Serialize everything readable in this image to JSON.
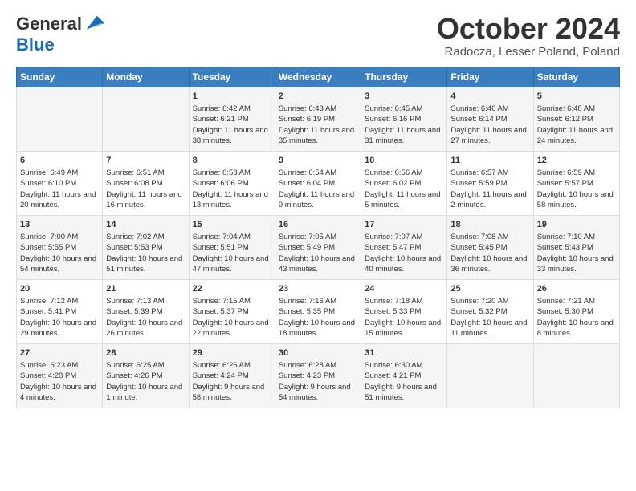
{
  "header": {
    "logo_line1": "General",
    "logo_line2": "Blue",
    "month": "October 2024",
    "location": "Radocza, Lesser Poland, Poland"
  },
  "days_of_week": [
    "Sunday",
    "Monday",
    "Tuesday",
    "Wednesday",
    "Thursday",
    "Friday",
    "Saturday"
  ],
  "weeks": [
    [
      {
        "day": "",
        "content": ""
      },
      {
        "day": "",
        "content": ""
      },
      {
        "day": "1",
        "content": "Sunrise: 6:42 AM\nSunset: 6:21 PM\nDaylight: 11 hours and 38 minutes."
      },
      {
        "day": "2",
        "content": "Sunrise: 6:43 AM\nSunset: 6:19 PM\nDaylight: 11 hours and 35 minutes."
      },
      {
        "day": "3",
        "content": "Sunrise: 6:45 AM\nSunset: 6:16 PM\nDaylight: 11 hours and 31 minutes."
      },
      {
        "day": "4",
        "content": "Sunrise: 6:46 AM\nSunset: 6:14 PM\nDaylight: 11 hours and 27 minutes."
      },
      {
        "day": "5",
        "content": "Sunrise: 6:48 AM\nSunset: 6:12 PM\nDaylight: 11 hours and 24 minutes."
      }
    ],
    [
      {
        "day": "6",
        "content": "Sunrise: 6:49 AM\nSunset: 6:10 PM\nDaylight: 11 hours and 20 minutes."
      },
      {
        "day": "7",
        "content": "Sunrise: 6:51 AM\nSunset: 6:08 PM\nDaylight: 11 hours and 16 minutes."
      },
      {
        "day": "8",
        "content": "Sunrise: 6:53 AM\nSunset: 6:06 PM\nDaylight: 11 hours and 13 minutes."
      },
      {
        "day": "9",
        "content": "Sunrise: 6:54 AM\nSunset: 6:04 PM\nDaylight: 11 hours and 9 minutes."
      },
      {
        "day": "10",
        "content": "Sunrise: 6:56 AM\nSunset: 6:02 PM\nDaylight: 11 hours and 5 minutes."
      },
      {
        "day": "11",
        "content": "Sunrise: 6:57 AM\nSunset: 5:59 PM\nDaylight: 11 hours and 2 minutes."
      },
      {
        "day": "12",
        "content": "Sunrise: 6:59 AM\nSunset: 5:57 PM\nDaylight: 10 hours and 58 minutes."
      }
    ],
    [
      {
        "day": "13",
        "content": "Sunrise: 7:00 AM\nSunset: 5:55 PM\nDaylight: 10 hours and 54 minutes."
      },
      {
        "day": "14",
        "content": "Sunrise: 7:02 AM\nSunset: 5:53 PM\nDaylight: 10 hours and 51 minutes."
      },
      {
        "day": "15",
        "content": "Sunrise: 7:04 AM\nSunset: 5:51 PM\nDaylight: 10 hours and 47 minutes."
      },
      {
        "day": "16",
        "content": "Sunrise: 7:05 AM\nSunset: 5:49 PM\nDaylight: 10 hours and 43 minutes."
      },
      {
        "day": "17",
        "content": "Sunrise: 7:07 AM\nSunset: 5:47 PM\nDaylight: 10 hours and 40 minutes."
      },
      {
        "day": "18",
        "content": "Sunrise: 7:08 AM\nSunset: 5:45 PM\nDaylight: 10 hours and 36 minutes."
      },
      {
        "day": "19",
        "content": "Sunrise: 7:10 AM\nSunset: 5:43 PM\nDaylight: 10 hours and 33 minutes."
      }
    ],
    [
      {
        "day": "20",
        "content": "Sunrise: 7:12 AM\nSunset: 5:41 PM\nDaylight: 10 hours and 29 minutes."
      },
      {
        "day": "21",
        "content": "Sunrise: 7:13 AM\nSunset: 5:39 PM\nDaylight: 10 hours and 26 minutes."
      },
      {
        "day": "22",
        "content": "Sunrise: 7:15 AM\nSunset: 5:37 PM\nDaylight: 10 hours and 22 minutes."
      },
      {
        "day": "23",
        "content": "Sunrise: 7:16 AM\nSunset: 5:35 PM\nDaylight: 10 hours and 18 minutes."
      },
      {
        "day": "24",
        "content": "Sunrise: 7:18 AM\nSunset: 5:33 PM\nDaylight: 10 hours and 15 minutes."
      },
      {
        "day": "25",
        "content": "Sunrise: 7:20 AM\nSunset: 5:32 PM\nDaylight: 10 hours and 11 minutes."
      },
      {
        "day": "26",
        "content": "Sunrise: 7:21 AM\nSunset: 5:30 PM\nDaylight: 10 hours and 8 minutes."
      }
    ],
    [
      {
        "day": "27",
        "content": "Sunrise: 6:23 AM\nSunset: 4:28 PM\nDaylight: 10 hours and 4 minutes."
      },
      {
        "day": "28",
        "content": "Sunrise: 6:25 AM\nSunset: 4:26 PM\nDaylight: 10 hours and 1 minute."
      },
      {
        "day": "29",
        "content": "Sunrise: 6:26 AM\nSunset: 4:24 PM\nDaylight: 9 hours and 58 minutes."
      },
      {
        "day": "30",
        "content": "Sunrise: 6:28 AM\nSunset: 4:23 PM\nDaylight: 9 hours and 54 minutes."
      },
      {
        "day": "31",
        "content": "Sunrise: 6:30 AM\nSunset: 4:21 PM\nDaylight: 9 hours and 51 minutes."
      },
      {
        "day": "",
        "content": ""
      },
      {
        "day": "",
        "content": ""
      }
    ]
  ]
}
